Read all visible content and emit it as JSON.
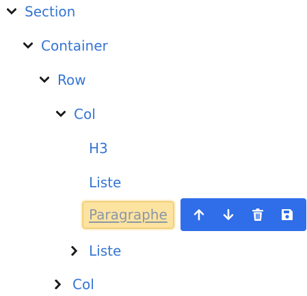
{
  "tree": {
    "section": {
      "label": "Section",
      "icon": "chevron-down-icon"
    },
    "container": {
      "label": "Container",
      "icon": "chevron-down-icon"
    },
    "row": {
      "label": "Row",
      "icon": "chevron-down-icon"
    },
    "col_1": {
      "label": "Col",
      "icon": "chevron-down-icon"
    },
    "h3": {
      "label": "H3"
    },
    "liste_1": {
      "label": "Liste"
    },
    "paragraphe": {
      "label": "Paragraphe",
      "selected": true
    },
    "liste_2": {
      "label": "Liste",
      "icon": "chevron-right-icon"
    },
    "col_2": {
      "label": "Col",
      "icon": "chevron-right-icon"
    }
  },
  "toolbar": {
    "buttons": [
      {
        "name": "move-up",
        "icon": "arrow-up-icon"
      },
      {
        "name": "move-down",
        "icon": "arrow-down-icon"
      },
      {
        "name": "delete",
        "icon": "trash-icon"
      },
      {
        "name": "save",
        "icon": "floppy-disk-icon"
      }
    ]
  },
  "colors": {
    "link": "#3575d3",
    "selected_bg": "#fde3a0",
    "selected_border": "#f2cf7a",
    "selected_text": "#8a96a8",
    "toolbar_bg": "#2f6ee8"
  }
}
